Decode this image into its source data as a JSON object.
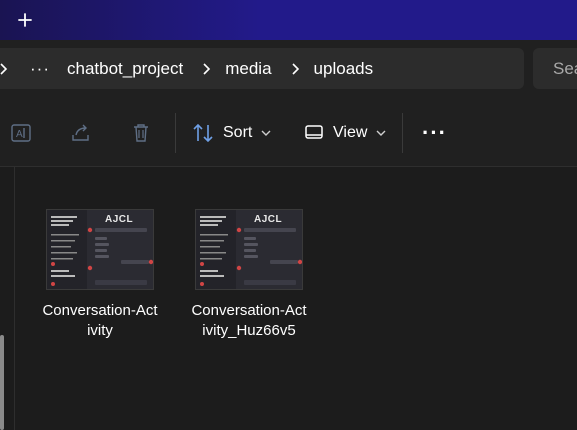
{
  "titlebar": {
    "new_tab_symbol": "+"
  },
  "address": {
    "more_label": "···",
    "crumbs": [
      "chatbot_project",
      "media",
      "uploads"
    ],
    "search_placeholder": "Sea"
  },
  "toolbar": {
    "sort_label": "Sort",
    "view_label": "View",
    "more_label": "···"
  },
  "files": [
    {
      "name_line1": "Conversation-Act",
      "name_line2": "ivity",
      "thumb_logo": "AJCL"
    },
    {
      "name_line1": "Conversation-Act",
      "name_line2": "ivity_Huz66v5",
      "thumb_logo": "AJCL"
    }
  ],
  "colors": {
    "accent": "#2a1fa0",
    "background": "#1c1c1c",
    "panel": "#202020",
    "breadcrumb_bg": "#2c2c2c"
  }
}
